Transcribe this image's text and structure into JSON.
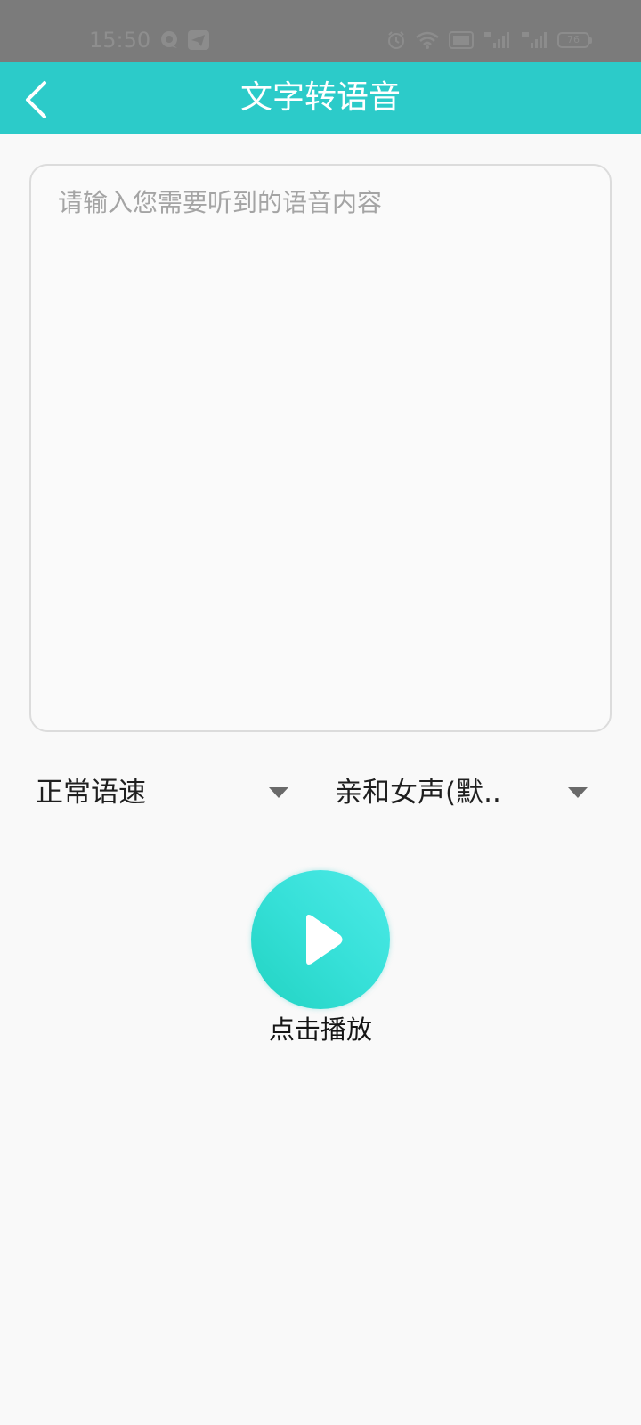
{
  "status_bar": {
    "time": "15:50",
    "battery": "76"
  },
  "header": {
    "title": "文字转语音",
    "back_icon": "chevron-left-icon"
  },
  "input": {
    "value": "",
    "placeholder": "请输入您需要听到的语音内容"
  },
  "speed_select": {
    "selected": "正常语速"
  },
  "voice_select": {
    "selected": "亲和女声(默.."
  },
  "play": {
    "label": "点击播放",
    "icon": "play-icon"
  },
  "colors": {
    "accent": "#2ccbc9",
    "status_bar": "#7b7b7b",
    "background": "#f9f9f9"
  }
}
